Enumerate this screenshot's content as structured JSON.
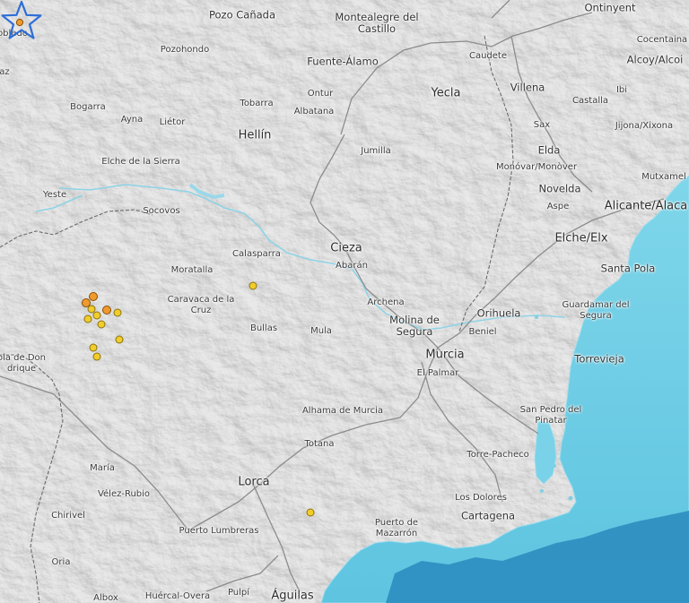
{
  "map": {
    "colors": {
      "land": "#d9d9d9",
      "sea": "#6ecde3",
      "deep_sea": "#2e8ec0",
      "roads": "#8c8c8c",
      "rivers": "#8fd3e6",
      "quake_minor": "#f1cc2b",
      "quake_major": "#ef9a2c",
      "epicenter_star": "#2f6fd6"
    },
    "places": [
      {
        "key": "pozo-canada",
        "label": "Pozo Cañada"
      },
      {
        "key": "montealegre",
        "label": "Montealegre del\nCastillo"
      },
      {
        "key": "ontinyent",
        "label": "Ontinyent"
      },
      {
        "key": "robledo",
        "label": "obledo"
      },
      {
        "key": "pozohondo",
        "label": "Pozohondo"
      },
      {
        "key": "fuente-alamo",
        "label": "Fuente-Álamo"
      },
      {
        "key": "caudete",
        "label": "Caudete"
      },
      {
        "key": "cocentaina",
        "label": "Cocentaina"
      },
      {
        "key": "alcoy",
        "label": "Alcoy/Alcoi"
      },
      {
        "key": "raz",
        "label": "az"
      },
      {
        "key": "ontur",
        "label": "Ontur"
      },
      {
        "key": "yecla",
        "label": "Yecla"
      },
      {
        "key": "villena",
        "label": "Villena"
      },
      {
        "key": "ibi",
        "label": "Ibi"
      },
      {
        "key": "bogarra",
        "label": "Bogarra"
      },
      {
        "key": "tobarra",
        "label": "Tobarra"
      },
      {
        "key": "albatana",
        "label": "Albatana"
      },
      {
        "key": "castalla",
        "label": "Castalla"
      },
      {
        "key": "ayna",
        "label": "Ayna"
      },
      {
        "key": "lietor",
        "label": "Liétor"
      },
      {
        "key": "sax",
        "label": "Sax"
      },
      {
        "key": "jijona",
        "label": "Jijona/Xixona"
      },
      {
        "key": "hellin",
        "label": "Hellín"
      },
      {
        "key": "jumilla",
        "label": "Jumilla"
      },
      {
        "key": "elda",
        "label": "Elda"
      },
      {
        "key": "elche-sierra",
        "label": "Elche de la Sierra"
      },
      {
        "key": "monovar",
        "label": "Monóvar/Monòver"
      },
      {
        "key": "mutxamel",
        "label": "Mutxamel"
      },
      {
        "key": "yeste",
        "label": "Yeste"
      },
      {
        "key": "novelda",
        "label": "Novelda"
      },
      {
        "key": "socovos",
        "label": "Socovos"
      },
      {
        "key": "aspe",
        "label": "Aspe"
      },
      {
        "key": "alicante",
        "label": "Alicante/Alaca"
      },
      {
        "key": "cieza",
        "label": "Cieza"
      },
      {
        "key": "elche",
        "label": "Elche/Elx"
      },
      {
        "key": "calasparra",
        "label": "Calasparra"
      },
      {
        "key": "abaran",
        "label": "Abarán"
      },
      {
        "key": "santa-pola",
        "label": "Santa Pola"
      },
      {
        "key": "moratalla",
        "label": "Moratalla"
      },
      {
        "key": "caravaca",
        "label": "Caravaca de la\nCruz"
      },
      {
        "key": "archena",
        "label": "Archena"
      },
      {
        "key": "guardamar",
        "label": "Guardamar del\nSegura"
      },
      {
        "key": "orihuela",
        "label": "Orihuela"
      },
      {
        "key": "molina",
        "label": "Molina de\nSegura"
      },
      {
        "key": "beniel",
        "label": "Beniel"
      },
      {
        "key": "puebla-don",
        "label": "ola de Don\ndrique"
      },
      {
        "key": "bullas",
        "label": "Bullas"
      },
      {
        "key": "mula",
        "label": "Mula"
      },
      {
        "key": "murcia",
        "label": "Murcia"
      },
      {
        "key": "torrevieja",
        "label": "Torrevieja"
      },
      {
        "key": "el-palmar",
        "label": "El Palmar"
      },
      {
        "key": "alhama",
        "label": "Alhama de Murcia"
      },
      {
        "key": "san-pedro",
        "label": "San Pedro del\nPinatar"
      },
      {
        "key": "totana",
        "label": "Totana"
      },
      {
        "key": "torre-pacheco",
        "label": "Torre-Pacheco"
      },
      {
        "key": "maria",
        "label": "María"
      },
      {
        "key": "lorca",
        "label": "Lorca"
      },
      {
        "key": "velez-rubio",
        "label": "Vélez-Rubio"
      },
      {
        "key": "los-dolores",
        "label": "Los Dolores"
      },
      {
        "key": "chirivel",
        "label": "Chirivel"
      },
      {
        "key": "cartagena",
        "label": "Cartagena"
      },
      {
        "key": "puerto-lumbreras",
        "label": "Puerto Lumbreras"
      },
      {
        "key": "puerto-mazarron",
        "label": "Puerto de\nMazarrón"
      },
      {
        "key": "oria",
        "label": "Oria"
      },
      {
        "key": "albox",
        "label": "Albox"
      },
      {
        "key": "huercal",
        "label": "Huércal-Overa"
      },
      {
        "key": "pulpi",
        "label": "Pulpí"
      },
      {
        "key": "aguilas",
        "label": "Águilas"
      }
    ],
    "quakes": [
      {
        "type": "minor"
      },
      {
        "type": "major"
      },
      {
        "type": "major"
      },
      {
        "type": "minor"
      },
      {
        "type": "minor"
      },
      {
        "type": "major"
      },
      {
        "type": "minor"
      },
      {
        "type": "minor"
      },
      {
        "type": "minor"
      },
      {
        "type": "minor"
      },
      {
        "type": "minor"
      },
      {
        "type": "minor"
      },
      {
        "type": "minor"
      }
    ],
    "epicenter": {
      "icon": "star-icon"
    }
  }
}
